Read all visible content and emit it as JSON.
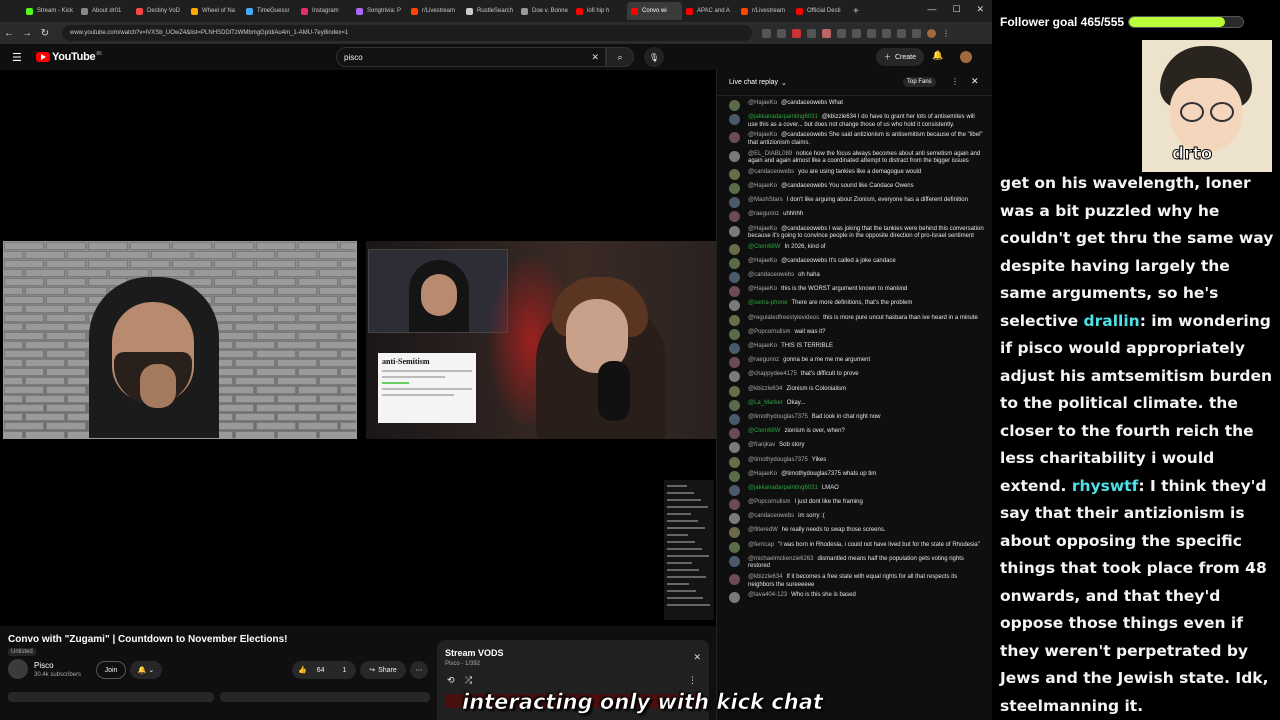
{
  "browser": {
    "tabs": [
      {
        "label": "Stream - Kick",
        "color": "#53fc18"
      },
      {
        "label": "About dr01",
        "color": "#888888"
      },
      {
        "label": "Destiny VoD",
        "color": "#ff4444"
      },
      {
        "label": "Wheel of Na",
        "color": "#ffaa00"
      },
      {
        "label": "TimeGuessr",
        "color": "#44aaff"
      },
      {
        "label": "Instagram",
        "color": "#e1306c"
      },
      {
        "label": "Songtrivia: P",
        "color": "#aa66ff"
      },
      {
        "label": "r/Livestream",
        "color": "#ff4500"
      },
      {
        "label": "RustleSearch",
        "color": "#cccccc"
      },
      {
        "label": "Doe v. Bonne",
        "color": "#999999"
      },
      {
        "label": "lofi hip h",
        "color": "#ff0000"
      },
      {
        "label": "Convo wi",
        "color": "#ff0000",
        "active": true
      },
      {
        "label": "APAC and A",
        "color": "#ff0000"
      },
      {
        "label": "r/Livestream",
        "color": "#ff4500"
      },
      {
        "label": "Official Desti",
        "color": "#ff0000"
      }
    ],
    "url": "www.youtube.com/watch?v=lVXSb_UOwZ4&list=PLNHSDDlTzWMbmgGpIdiAu4m_1-AMU-7ey8index=1"
  },
  "youtube": {
    "logo_text": "YouTube",
    "logo_sup": "86",
    "search_value": "pisco",
    "create_label": "Create"
  },
  "video": {
    "def_word": "anti-Semitism",
    "title": "Convo with \"Zugami\" | Countdown to November Elections!",
    "unlisted": "Unlisted",
    "channel": "Pisco",
    "subs": "30.4k subscribers",
    "join": "Join",
    "likes": "64",
    "dislikes": "1",
    "share": "Share"
  },
  "playlist": {
    "title": "Stream VODS",
    "sub": "Pisco - 1/392"
  },
  "chat": {
    "header": "Live chat replay",
    "top_fans": "Top Fans",
    "messages": [
      {
        "author": "@HajaeKo",
        "text": "@candaceowebs What",
        "member": false
      },
      {
        "author": "@jakkanadarpainting6031",
        "text": "@kbizzle634 I do have to grant her lots of antisemites will use this as a cover... but does not change those of us who hold it consistently.",
        "member": true
      },
      {
        "author": "@HajaeKo",
        "text": "@candaceowebs She said antizionism is antisemitism because of the \"libel\" that antizionism claims.",
        "member": false
      },
      {
        "author": "@EL_DIABL089",
        "text": "notice how the focus always becomes about anti semetism again and again and again almost like a coordinated attempt to distract from the bigger issues",
        "member": false
      },
      {
        "author": "@candaceowebs",
        "text": "you are using tankies like a demagogue would",
        "member": false
      },
      {
        "author": "@HajaeKo",
        "text": "@candaceowebs You sound like Candace Owens",
        "member": false
      },
      {
        "author": "@MashStars",
        "text": "I don't like arguing about Zionism, everyone has a different definition",
        "member": false
      },
      {
        "author": "@raegunnz",
        "text": "uhhhhh",
        "member": false
      },
      {
        "author": "@HajaeKo",
        "text": "@candaceowebs I was joking that the tankies were behind this conversation because it's going to convince people in the opposite direction of pro-Israel sentiment",
        "member": false
      },
      {
        "author": "@Clem68W",
        "text": "In 2026, kind of",
        "member": true
      },
      {
        "author": "@HajaeKo",
        "text": "@candaceowebs It's called a joke candace",
        "member": false
      },
      {
        "author": "@candaceowebs",
        "text": "oh haha",
        "member": false
      },
      {
        "author": "@HajaeKo",
        "text": "this is the WORST argument known to mankind",
        "member": false
      },
      {
        "author": "@sema-phone",
        "text": "There are more definitions, that's the problem",
        "member": true
      },
      {
        "author": "@regulatedfreestylevideos",
        "text": "this is more pure uncut hasbara than ive heard in a minute",
        "member": false
      },
      {
        "author": "@Popcornulism",
        "text": "wait was it?",
        "member": false
      },
      {
        "author": "@HajaeKo",
        "text": "THIS IS TERRIBLE",
        "member": false
      },
      {
        "author": "@raegunnz",
        "text": "gonna be a me me me argument",
        "member": false
      },
      {
        "author": "@chappydee4175",
        "text": "that's difficult to prove",
        "member": false
      },
      {
        "author": "@kbizzle634",
        "text": "Zionism is Colonialism",
        "member": false
      },
      {
        "author": "@La_Marker",
        "text": "Okay...",
        "member": true
      },
      {
        "author": "@timothydouglas7375",
        "text": "Bad look in chat right now",
        "member": false
      },
      {
        "author": "@Clem68W",
        "text": "zionism is over, when?",
        "member": true
      },
      {
        "author": "@franjkav",
        "text": "Sob story",
        "member": false
      },
      {
        "author": "@timothydouglas7375",
        "text": "Yikes",
        "member": false
      },
      {
        "author": "@HajaeKo",
        "text": "@timothydouglas7375 whats up tim",
        "member": false
      },
      {
        "author": "@jakkanadarpainting6031",
        "text": "LMAO",
        "member": true
      },
      {
        "author": "@Popcornulism",
        "text": "I just dont like the framing",
        "member": false
      },
      {
        "author": "@candaceowebs",
        "text": "im sorry :(",
        "member": false
      },
      {
        "author": "@filteredW",
        "text": "he really needs to swap those screens.",
        "member": false
      },
      {
        "author": "@ferricap",
        "text": "\"I was born in Rhodesia, i could not have lived but for the state of Rhodesia\"",
        "member": false
      },
      {
        "author": "@michaelmckenzie6263",
        "text": "dismantled means half the population gets voting rights restored",
        "member": false
      },
      {
        "author": "@kbizzle634",
        "text": "If it becomes a free state with equal rights for all that respects its neighbors the sureeeeee",
        "member": false
      },
      {
        "author": "@lava404-123",
        "text": "Who is this she is based",
        "member": false
      }
    ]
  },
  "overlay": {
    "goal_text": "Follower goal 465/555",
    "goal_progress": 0.838,
    "goal_color": "#b9ff3a",
    "avatar_name": "drto",
    "username_color": "#4fe0e6",
    "lines": [
      {
        "user": "",
        "text": "get on his wavelength, loner was a bit puzzled why he couldn't get thru the same way despite having largely the same arguments, so he's selective"
      },
      {
        "user": "drallin",
        "text": "im wondering if pisco would appropriately adjust his amtsemitism burden to the political climate. the closer to the fourth reich the less charitability i would extend."
      },
      {
        "user": "rhyswtf",
        "text": "I think they'd say that their antizionism is about opposing the specific things that took place from 48 onwards, and that they'd oppose those things even if they weren't perpetrated by Jews and the Jewish state. Idk, steelmanning it."
      }
    ]
  },
  "caption": "interacting only with kick chat"
}
